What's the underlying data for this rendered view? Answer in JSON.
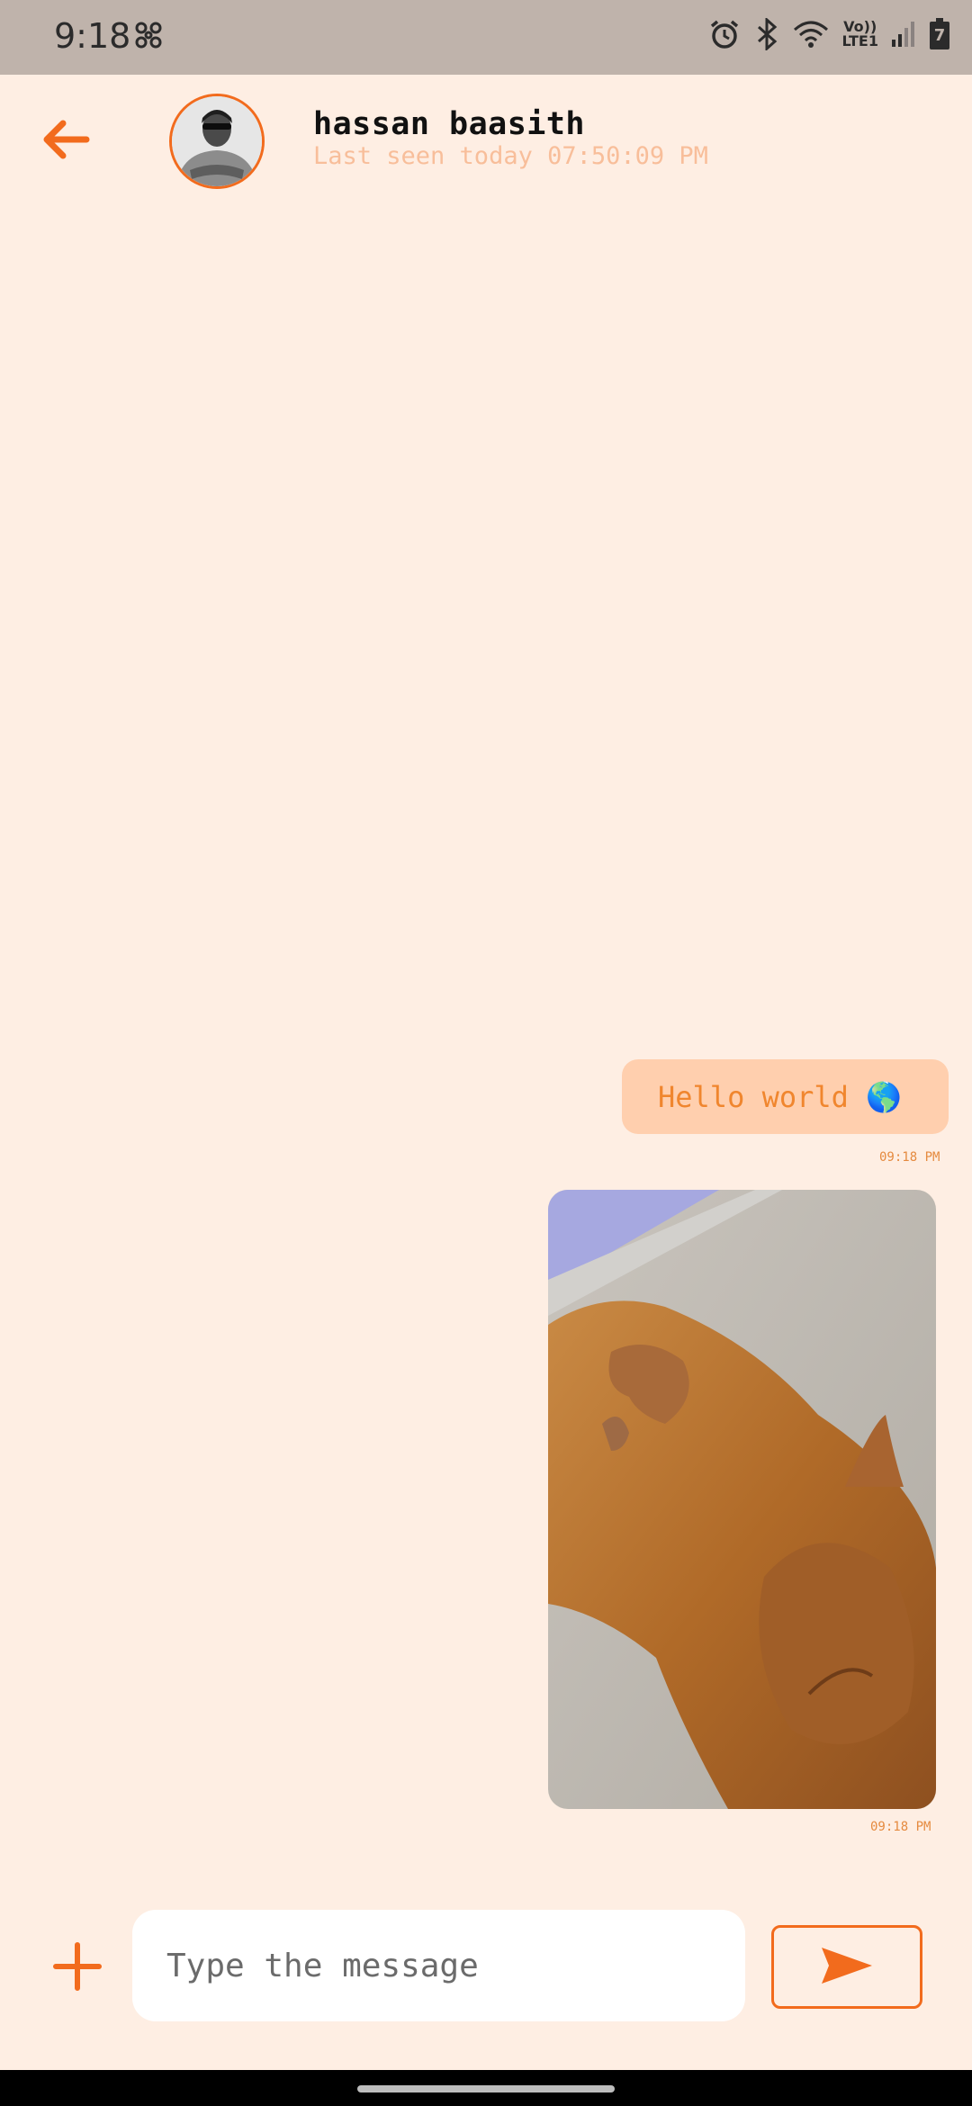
{
  "status_bar": {
    "time": "9:18",
    "network_label_top": "Vo))",
    "network_label_bottom": "LTE1",
    "battery_level": "7"
  },
  "header": {
    "contact_name": "hassan baasith",
    "last_seen": "Last seen today 07:50:09 PM"
  },
  "messages": [
    {
      "type": "text",
      "text": "Hello world 🌎",
      "time": "09:18 PM"
    },
    {
      "type": "image",
      "time": "09:18 PM"
    }
  ],
  "composer": {
    "placeholder": "Type the message",
    "value": ""
  },
  "colors": {
    "accent": "#F26B1D",
    "background": "#FEEEE3",
    "bubble": "#FFCFAE",
    "last_seen": "#F8BE9A"
  }
}
